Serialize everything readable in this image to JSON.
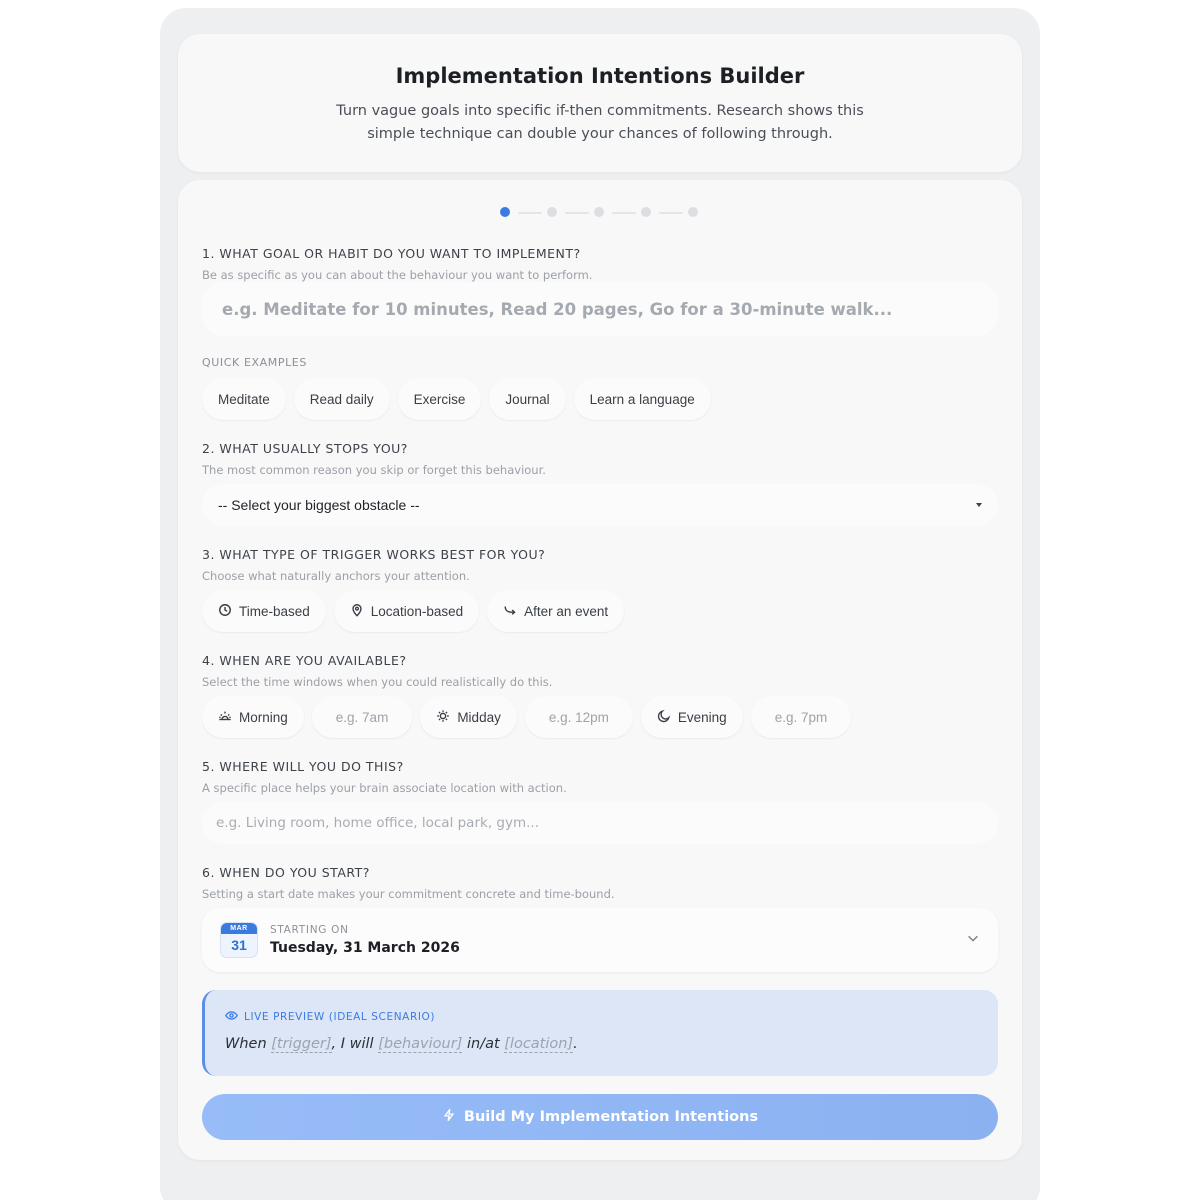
{
  "header": {
    "title": "Implementation Intentions Builder",
    "subtitle": "Turn vague goals into specific if-then commitments. Research shows this simple technique can double your chances of following through."
  },
  "progress": {
    "current_step": 1,
    "total_steps": 6
  },
  "q1": {
    "title": "1. WHAT GOAL OR HABIT DO YOU WANT TO IMPLEMENT?",
    "subtitle": "Be as specific as you can about the behaviour you want to perform.",
    "placeholder": "e.g. Meditate for 10 minutes, Read 20 pages, Go for a 30-minute walk..."
  },
  "quick_examples": {
    "label": "QUICK EXAMPLES",
    "items": [
      "Meditate",
      "Read daily",
      "Exercise",
      "Journal",
      "Learn a language"
    ]
  },
  "q2": {
    "title": "2. WHAT USUALLY STOPS YOU?",
    "subtitle": "The most common reason you skip or forget this behaviour.",
    "select_value": "-- Select your biggest obstacle --"
  },
  "q3": {
    "title": "3. WHAT TYPE OF TRIGGER WORKS BEST FOR YOU?",
    "subtitle": "Choose what naturally anchors your attention.",
    "options": [
      {
        "label": "Time-based",
        "icon": "clock-icon"
      },
      {
        "label": "Location-based",
        "icon": "map-pin-icon"
      },
      {
        "label": "After an event",
        "icon": "arrow-turn-icon"
      }
    ]
  },
  "q4": {
    "title": "4. WHEN ARE YOU AVAILABLE?",
    "subtitle": "Select the time windows when you could realistically do this.",
    "slots": [
      {
        "label": "Morning",
        "icon": "sunrise-icon",
        "time_placeholder": "e.g. 7am"
      },
      {
        "label": "Midday",
        "icon": "sun-icon",
        "time_placeholder": "e.g. 12pm"
      },
      {
        "label": "Evening",
        "icon": "moon-icon",
        "time_placeholder": "e.g. 7pm"
      }
    ]
  },
  "q5": {
    "title": "5. WHERE WILL YOU DO THIS?",
    "subtitle": "A specific place helps your brain associate location with action.",
    "placeholder": "e.g. Living room, home office, local park, gym..."
  },
  "q6": {
    "title": "6. WHEN DO YOU START?",
    "subtitle": "Setting a start date makes your commitment concrete and time-bound.",
    "calendar_month": "MAR",
    "calendar_day": "31",
    "label": "STARTING ON",
    "value": "Tuesday, 31 March 2026"
  },
  "preview": {
    "label": "LIVE PREVIEW (IDEAL SCENARIO)",
    "when": "When",
    "trigger": "[trigger]",
    "i_will": ", I will",
    "behaviour": "[behaviour]",
    "in_at": "in/at",
    "location": "[location]",
    "end": "."
  },
  "build_button": {
    "label": "Build My Implementation Intentions"
  },
  "colors": {
    "accent": "#3b7be0",
    "preview_bg": "#dce6f7",
    "button": "#97bcf8"
  }
}
